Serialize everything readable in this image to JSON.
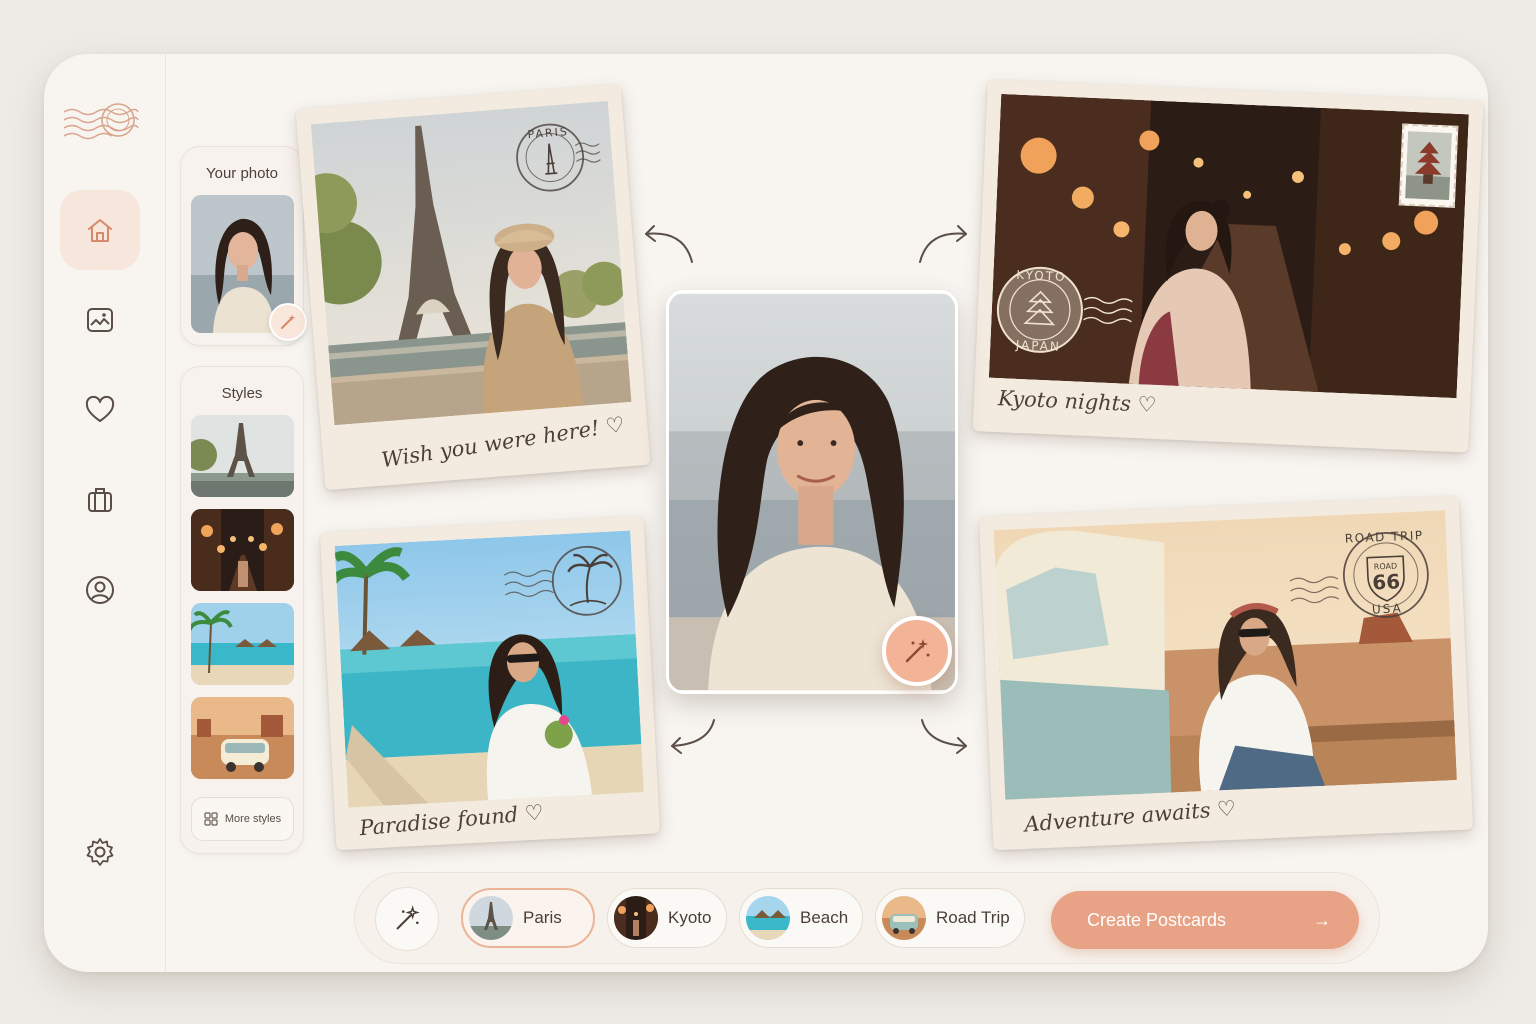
{
  "nav": {
    "items": [
      {
        "id": "home",
        "icon": "home-icon",
        "active": true
      },
      {
        "id": "gallery",
        "icon": "image-icon",
        "active": false
      },
      {
        "id": "favorites",
        "icon": "heart-icon",
        "active": false
      },
      {
        "id": "trips",
        "icon": "suitcase-icon",
        "active": false
      },
      {
        "id": "profile",
        "icon": "user-icon",
        "active": false
      }
    ],
    "settings_icon": "gear-icon"
  },
  "your_photo": {
    "title": "Your photo",
    "edit_icon": "magic-wand-icon"
  },
  "styles_panel": {
    "title": "Styles",
    "items": [
      "Paris",
      "Kyoto",
      "Beach",
      "Road Trip"
    ],
    "more_label": "More styles"
  },
  "postcards": [
    {
      "style": "Paris",
      "caption": "Wish you were here! ♡",
      "stamp": "PARIS"
    },
    {
      "style": "Kyoto",
      "caption": "Kyoto nights ♡",
      "stamp": "KYOTO JAPAN"
    },
    {
      "style": "Beach",
      "caption": "Paradise found ♡",
      "stamp": "palm-tree-stamp"
    },
    {
      "style": "Road Trip",
      "caption": "Adventure awaits ♡",
      "stamp": "ROAD TRIP 66 USA"
    }
  ],
  "stamps": {
    "paris": "PARIS",
    "kyoto_top": "KYOTO",
    "kyoto_bottom": "JAPAN",
    "road_top": "ROAD TRIP",
    "road_mid": "ROAD",
    "road_num": "66",
    "road_bottom": "USA"
  },
  "bottom_bar": {
    "chips": [
      {
        "label": "Paris",
        "selected": true
      },
      {
        "label": "Kyoto",
        "selected": false
      },
      {
        "label": "Beach",
        "selected": false
      },
      {
        "label": "Road Trip",
        "selected": false
      }
    ],
    "create_label": "Create Postcards",
    "create_arrow": "→"
  },
  "colors": {
    "accent": "#e8a386",
    "accent_light": "#f6e6dc",
    "background": "#f8f5f1",
    "card": "#f3ebdf"
  }
}
